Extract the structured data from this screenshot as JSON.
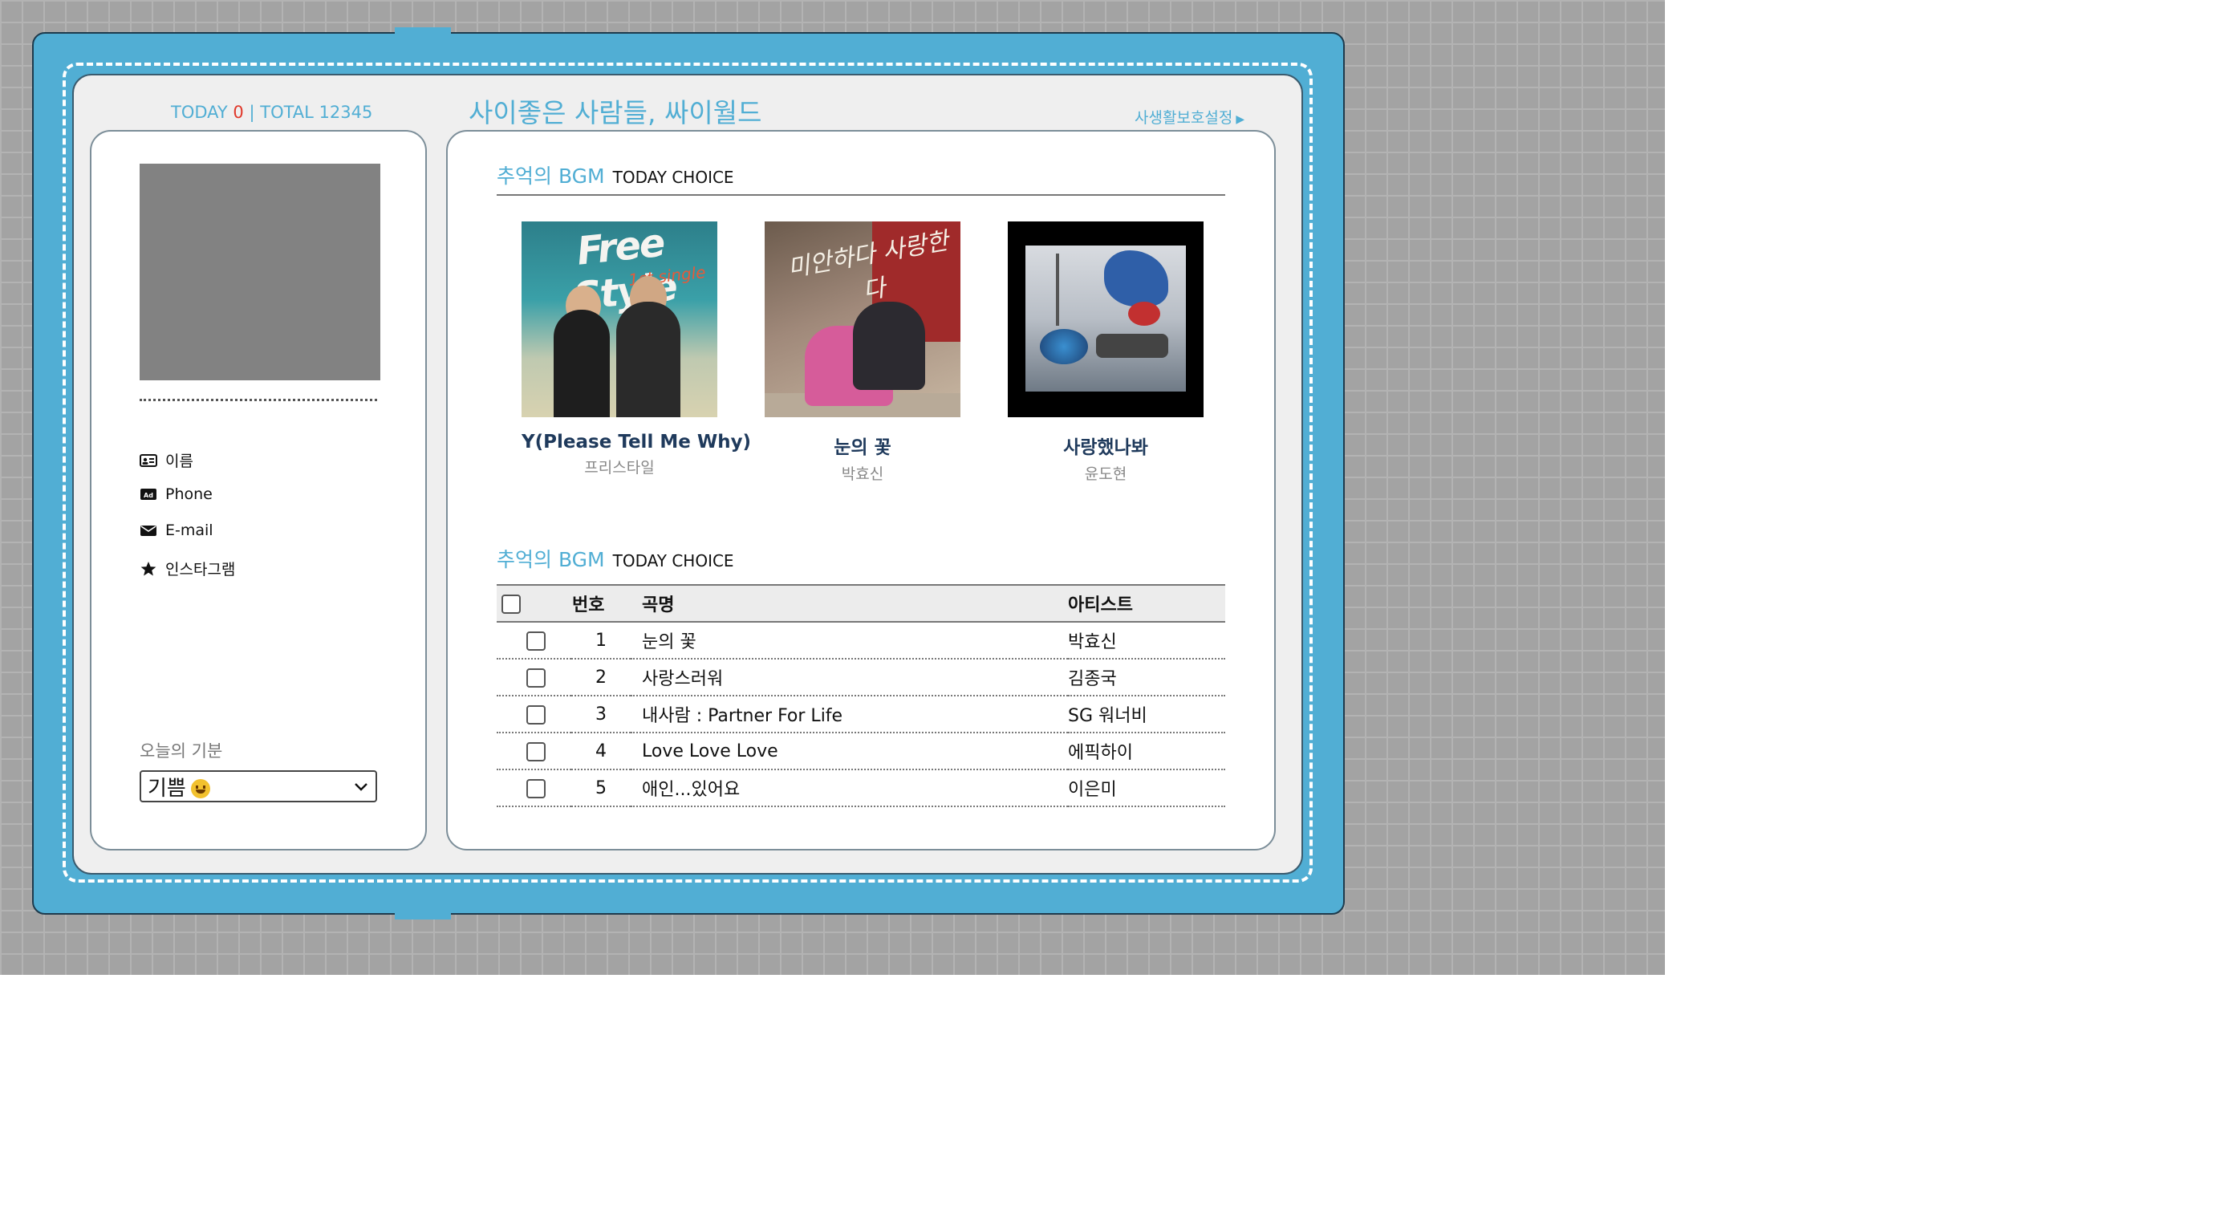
{
  "header": {
    "today_label": "TODAY",
    "today_count": "0",
    "separator": "|",
    "total_label": "TOTAL",
    "total_count": "12345",
    "site_title": "사이좋은 사람들, 싸이월드",
    "privacy_link": "사생활보호설정",
    "privacy_arrow": "▶"
  },
  "profile": {
    "info_items": [
      {
        "icon": "id-card-icon",
        "label": "이름"
      },
      {
        "icon": "contact-card-icon",
        "label": "Phone"
      },
      {
        "icon": "envelope-icon",
        "label": "E-mail"
      },
      {
        "icon": "star-icon",
        "label": "인스타그램"
      }
    ],
    "mood_label": "오늘의 기분",
    "mood_value": "기쁨",
    "mood_emoji": "smiling-face-icon"
  },
  "bgm_section1": {
    "title": "추억의 BGM",
    "subtitle": "TODAY CHOICE",
    "albums": [
      {
        "title": "Y(Please Tell Me Why)",
        "artist": "프리스타일",
        "art_text": "Free Style",
        "art_sub": "1st single"
      },
      {
        "title": "눈의 꽃",
        "artist": "박효신",
        "art_text": "미안하다 사랑한다"
      },
      {
        "title": "사랑했나봐",
        "artist": "윤도현"
      }
    ]
  },
  "bgm_section2": {
    "title": "추억의 BGM",
    "subtitle": "TODAY CHOICE",
    "columns": [
      "번호",
      "곡명",
      "아티스트"
    ],
    "rows": [
      {
        "num": "1",
        "title": "눈의 꽃",
        "artist": "박효신"
      },
      {
        "num": "2",
        "title": "사랑스러워",
        "artist": "김종국"
      },
      {
        "num": "3",
        "title": "내사람 : Partner For Life",
        "artist": "SG 워너비"
      },
      {
        "num": "4",
        "title": "Love Love Love",
        "artist": "에픽하이"
      },
      {
        "num": "5",
        "title": "애인...있어요",
        "artist": "이은미"
      }
    ]
  },
  "colors": {
    "frame": "#51aed4",
    "accent_text": "#51aed4",
    "today_count": "#e0392b",
    "album_title": "#1f3a5c"
  }
}
